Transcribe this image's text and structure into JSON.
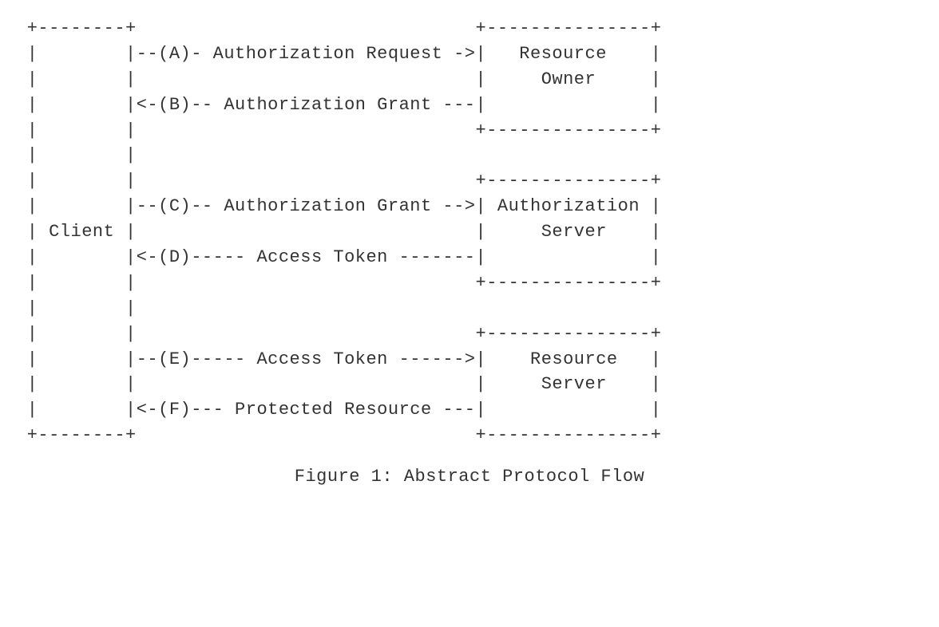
{
  "diagram": {
    "left_box_label": "Client",
    "right_boxes": [
      {
        "line1": "Resource",
        "line2": "Owner"
      },
      {
        "line1": "Authorization",
        "line2": "Server"
      },
      {
        "line1": "Resource",
        "line2": "Server"
      }
    ],
    "flows": [
      {
        "step": "A",
        "label": "Authorization Request",
        "direction": "right"
      },
      {
        "step": "B",
        "label": "Authorization Grant",
        "direction": "left"
      },
      {
        "step": "C",
        "label": "Authorization Grant",
        "direction": "right"
      },
      {
        "step": "D",
        "label": "Access Token",
        "direction": "left"
      },
      {
        "step": "E",
        "label": "Access Token",
        "direction": "right"
      },
      {
        "step": "F",
        "label": "Protected Resource",
        "direction": "left"
      }
    ],
    "caption": "Figure 1: Abstract Protocol Flow",
    "lines": {
      "l00": " +--------+                               +---------------+",
      "l01": " |        |--(A)- Authorization Request ->|   Resource    |",
      "l02": " |        |                               |     Owner     |",
      "l03": " |        |<-(B)-- Authorization Grant ---|               |",
      "l04": " |        |                               +---------------+",
      "l05": " |        |",
      "l06": " |        |                               +---------------+",
      "l07": " |        |--(C)-- Authorization Grant -->| Authorization |",
      "l08": " | Client |                               |     Server    |",
      "l09": " |        |<-(D)----- Access Token -------|               |",
      "l10": " |        |                               +---------------+",
      "l11": " |        |",
      "l12": " |        |                               +---------------+",
      "l13": " |        |--(E)----- Access Token ------>|    Resource   |",
      "l14": " |        |                               |     Server    |",
      "l15": " |        |<-(F)--- Protected Resource ---|               |",
      "l16": " +--------+                               +---------------+"
    }
  }
}
